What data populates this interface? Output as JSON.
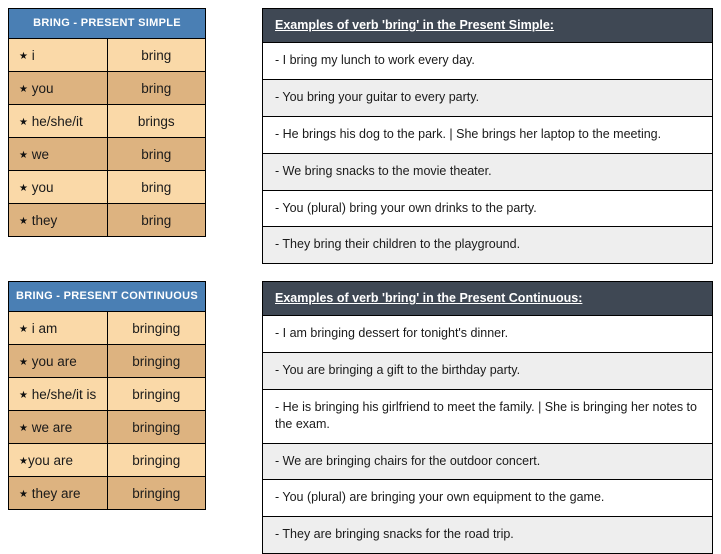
{
  "tables": [
    {
      "id": "present-simple",
      "title": "BRING - PRESENT SIMPLE",
      "star_glyph": "★",
      "rows": [
        {
          "subject": "i",
          "form": "bring"
        },
        {
          "subject": "you",
          "form": "bring"
        },
        {
          "subject": "he/she/it",
          "form": "brings"
        },
        {
          "subject": "we",
          "form": "bring"
        },
        {
          "subject": "you",
          "form": "bring"
        },
        {
          "subject": "they",
          "form": "bring"
        }
      ]
    },
    {
      "id": "present-continuous",
      "title": "BRING - PRESENT CONTINUOUS",
      "star_glyph": "★",
      "rows": [
        {
          "subject": "i am",
          "form": "bringing"
        },
        {
          "subject": "you are",
          "form": "bringing"
        },
        {
          "subject": "he/she/it is",
          "form": "bringing"
        },
        {
          "subject": "we are",
          "form": "bringing"
        },
        {
          "subject": "you are",
          "form": "bringing"
        },
        {
          "subject": "they are",
          "form": "bringing"
        }
      ]
    }
  ],
  "examples": [
    {
      "id": "present-simple",
      "title": "Examples of verb 'bring' in the Present Simple:",
      "items": [
        "- I bring my lunch to work every day.",
        "- You bring your guitar to every party.",
        "- He brings his dog to the park. | She brings her laptop to the meeting.",
        "- We bring snacks to the movie theater.",
        "- You (plural) bring your own drinks to the party.",
        "- They bring their children to the playground."
      ]
    },
    {
      "id": "present-continuous",
      "title": "Examples of verb 'bring' in the Present Continuous:",
      "items": [
        "- I am bringing dessert for tonight's dinner.",
        "- You are bringing a gift to the birthday party.",
        "- He is bringing his girlfriend to meet the family. | She is bringing her notes to the exam.",
        "- We are bringing chairs for the outdoor concert.",
        "- You (plural) are bringing your own equipment to the game.",
        "- They are bringing snacks for the road trip."
      ]
    }
  ],
  "colors": {
    "table_header_blue": "#4a7fb4",
    "row_light": "#fad9a8",
    "row_dark": "#ddb380",
    "panel_header_slate": "#3f4854",
    "row_stripe_gray": "#eeeeee",
    "border": "#000000"
  }
}
